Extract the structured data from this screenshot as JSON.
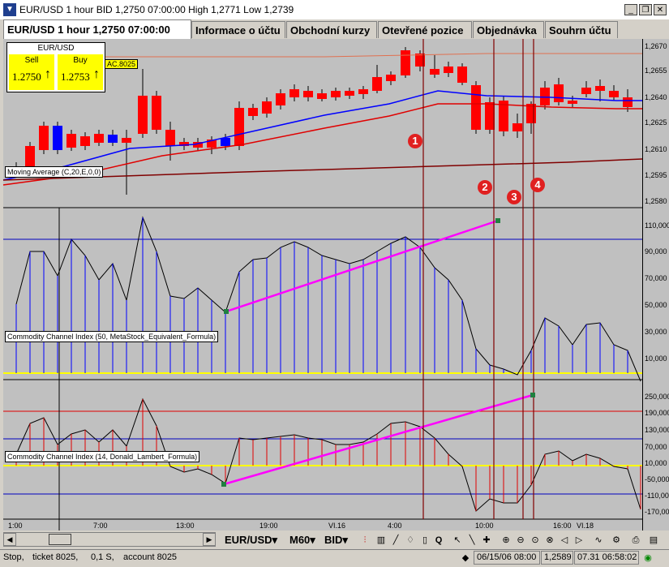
{
  "window": {
    "title": "EUR/USD 1 hour BID 1,2750 07:00:00 High 1,2771 Low 1,2739",
    "icon": "app-logo-icon",
    "buttons": [
      "minimize-icon",
      "restore-icon",
      "close-icon"
    ]
  },
  "tabs": [
    {
      "label": "EUR/USD 1 hour 1,2750 07:00:00",
      "active": true
    },
    {
      "label": "Informace o účtu"
    },
    {
      "label": "Obchodní kurzy"
    },
    {
      "label": "Otevřené pozice"
    },
    {
      "label": "Objednávka"
    },
    {
      "label": "Souhrn účtu"
    }
  ],
  "quote": {
    "pair": "EUR/USD",
    "sell_label": "Sell",
    "buy_label": "Buy",
    "sell_price": "1.2750",
    "buy_price": "1.2753",
    "sell_arrow": "↑",
    "buy_arrow": "↑",
    "tag": "AC.8025"
  },
  "indicators": {
    "ma_label": "Moving Average (C,20,E,0,0)",
    "cci1_label": "Commodity Channel Index (50, MetaStock_Equivalent_Formula)",
    "cci2_label": "Commodity Channel Index (14, Donald_Lambert_Formula)"
  },
  "markers": [
    "1",
    "2",
    "3",
    "4"
  ],
  "axes": {
    "price_ticks": [
      "1,2670",
      "1,2655",
      "1,2640",
      "1,2625",
      "1,2610",
      "1,2595",
      "1,2580"
    ],
    "cci1_ticks": [
      "110,000",
      "90,000",
      "70,000",
      "50,000",
      "30,000",
      "10,000"
    ],
    "cci2_ticks": [
      "250,000",
      "190,000",
      "130,000",
      "70,000",
      "10,000",
      "-50,000",
      "-110,000",
      "-170,000"
    ],
    "time_ticks": [
      "1:00",
      "7:00",
      "13:00",
      "19:00",
      "VI.16",
      "4:00",
      "10:00",
      "16:00",
      "VI.18"
    ]
  },
  "toolbar": {
    "symbol": "EUR/USD",
    "period": "M60",
    "side": "BID",
    "dropdown_arrow": "▾"
  },
  "status": {
    "order": "Stop,",
    "ticket": "ticket 8025,",
    "lots": "0,1 S,",
    "account": "account 8025",
    "cursor_time": "06/15/06 08:00",
    "cursor_price": "1,2589",
    "server_time": "07.31 06:58:02"
  },
  "colors": {
    "chart_bg": "#c0c0c0",
    "bull": "#0000ff",
    "bear": "#ff0000",
    "trend": "#ff00ff",
    "zero": "#ffff00",
    "marker": "#e02020"
  }
}
